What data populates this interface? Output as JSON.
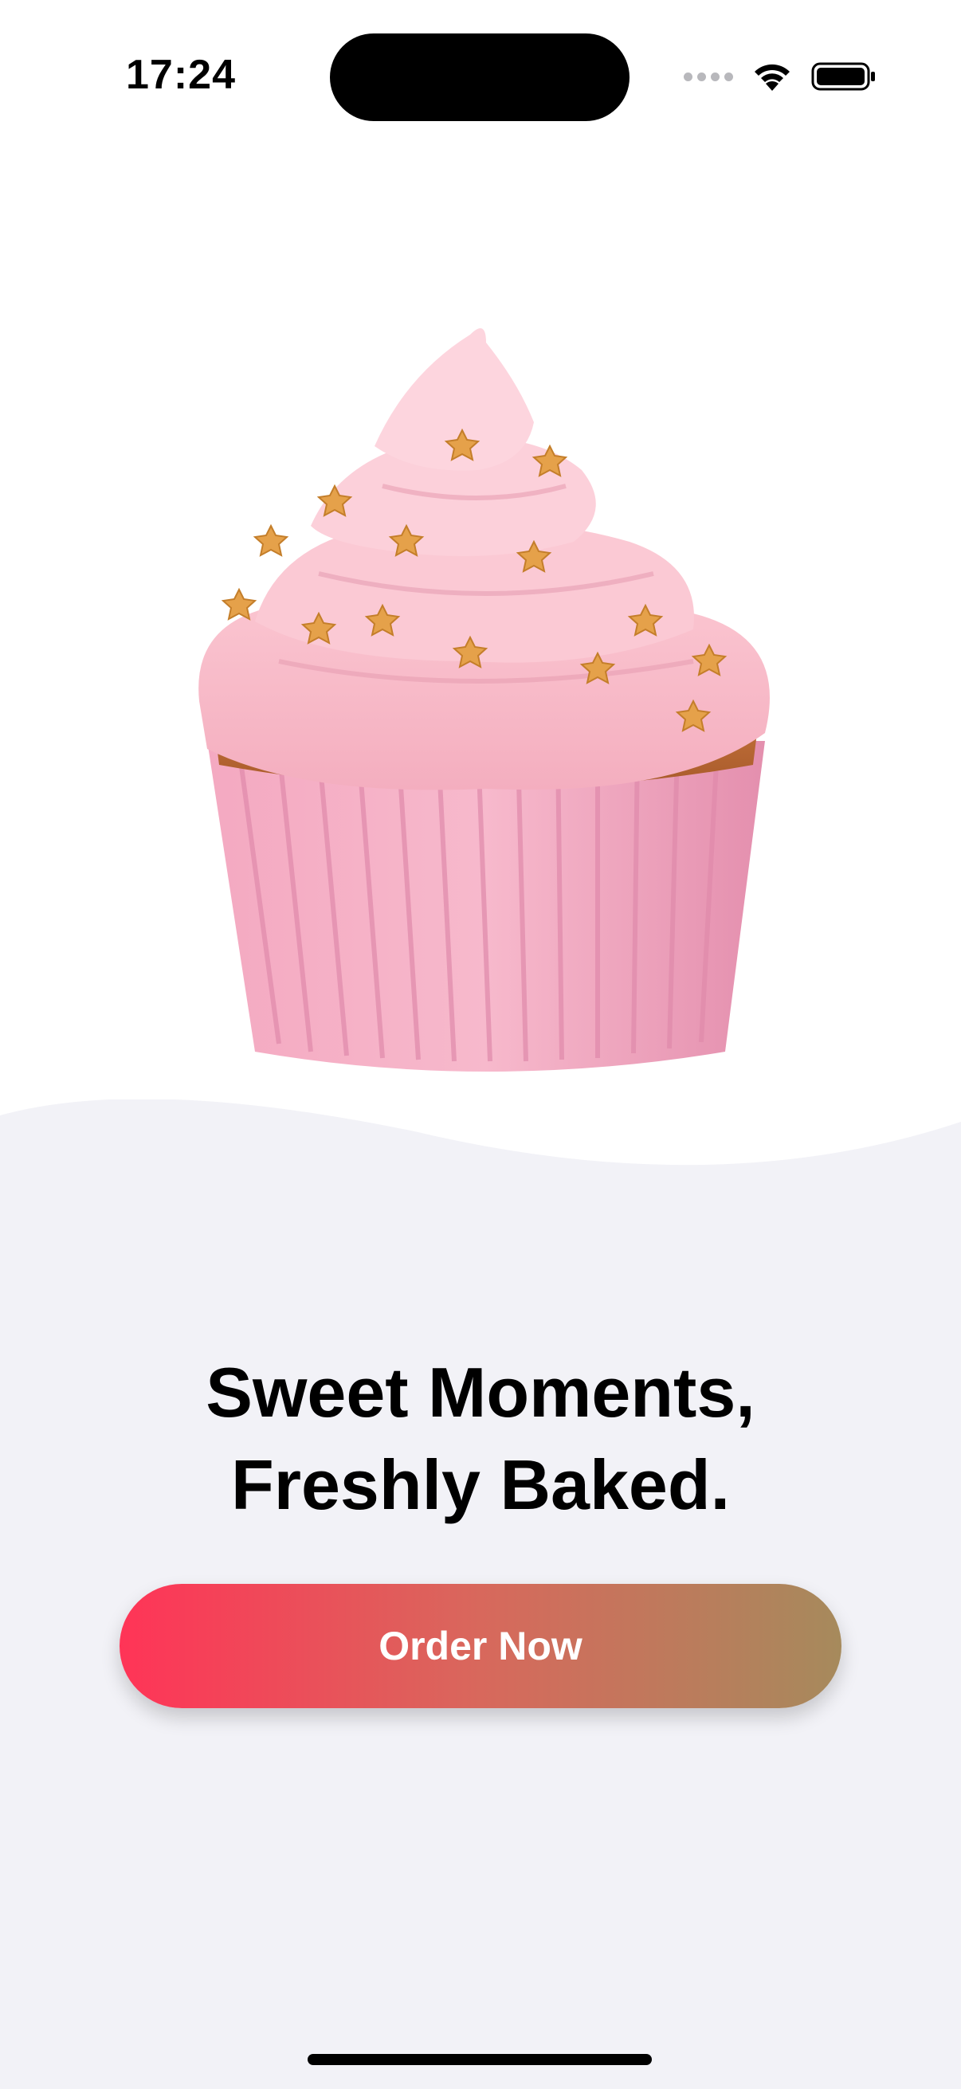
{
  "status_bar": {
    "time": "17:24",
    "icons": [
      "cellular-signal-icon",
      "wifi-icon",
      "battery-icon"
    ]
  },
  "hero": {
    "image": "cupcake-image",
    "description_icon": "cupcake-icon"
  },
  "headline": {
    "line1": "Sweet Moments,",
    "line2": "Freshly Baked."
  },
  "cta": {
    "label": "Order Now"
  },
  "colors": {
    "background_top": "#ffffff",
    "background_bottom": "#f2f2f7",
    "button_gradient_start": "#ff3457",
    "button_gradient_end": "#a68a5c",
    "frosting": "#f7b7c4",
    "liner": "#f1a8c0"
  }
}
